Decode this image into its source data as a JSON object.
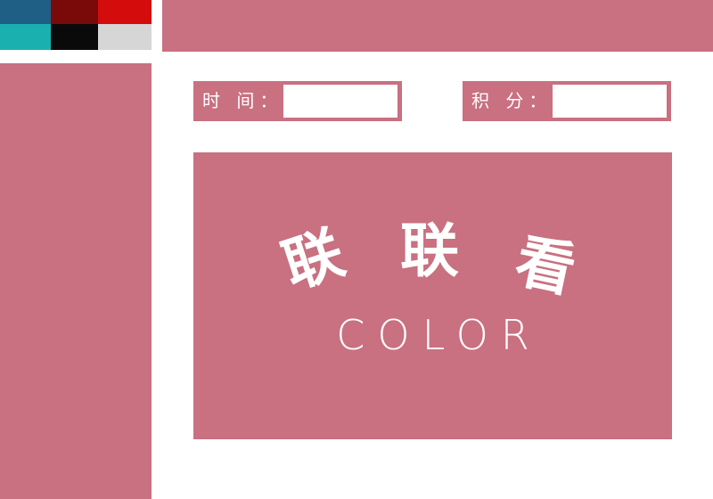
{
  "palette": {
    "colors": [
      "#1f5f85",
      "#7a0a0a",
      "#d40c0c",
      "#1ab0b0",
      "#0a0a0a",
      "#d6d6d6"
    ]
  },
  "theme": {
    "accent": "#c97081",
    "background": "#ffffff"
  },
  "hud": {
    "time_label": "时 间：",
    "time_value": "",
    "score_label": "积 分：",
    "score_value": ""
  },
  "board": {
    "title_chars": [
      "联",
      "联",
      "看"
    ],
    "subtitle": "COLOR"
  }
}
